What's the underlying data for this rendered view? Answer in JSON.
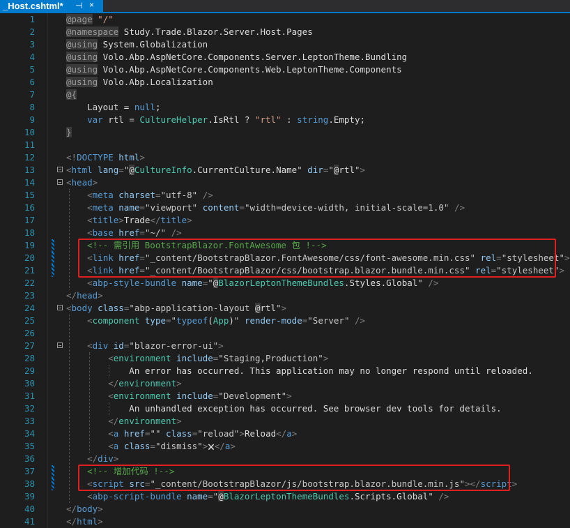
{
  "tab": {
    "title": "_Host.cshtml*",
    "pin_glyph": "⊣",
    "close_glyph": "×"
  },
  "lines": [
    {
      "n": "1",
      "tokens": [
        [
          "dir",
          "@page"
        ],
        [
          "txt",
          " "
        ],
        [
          "str",
          "\"/\""
        ]
      ]
    },
    {
      "n": "2",
      "tokens": [
        [
          "dir",
          "@namespace"
        ],
        [
          "txt",
          " Study.Trade.Blazor.Server.Host.Pages"
        ]
      ]
    },
    {
      "n": "3",
      "tokens": [
        [
          "dir",
          "@using"
        ],
        [
          "txt",
          " System.Globalization"
        ]
      ]
    },
    {
      "n": "4",
      "tokens": [
        [
          "dir",
          "@using"
        ],
        [
          "txt",
          " Volo.Abp.AspNetCore.Components.Server.LeptonTheme.Bundling"
        ]
      ]
    },
    {
      "n": "5",
      "tokens": [
        [
          "dir",
          "@using"
        ],
        [
          "txt",
          " Volo.Abp.AspNetCore.Components.Web.LeptonTheme.Components"
        ]
      ]
    },
    {
      "n": "6",
      "tokens": [
        [
          "dir",
          "@using"
        ],
        [
          "txt",
          " Volo.Abp.Localization"
        ]
      ]
    },
    {
      "n": "7",
      "tokens": [
        [
          "dir",
          "@{"
        ]
      ]
    },
    {
      "n": "8",
      "tokens": [
        [
          "txt",
          "    Layout = "
        ],
        [
          "kw",
          "null"
        ],
        [
          "txt",
          ";"
        ]
      ]
    },
    {
      "n": "9",
      "tokens": [
        [
          "txt",
          "    "
        ],
        [
          "kw",
          "var"
        ],
        [
          "txt",
          " rtl = "
        ],
        [
          "type",
          "CultureHelper"
        ],
        [
          "txt",
          ".IsRtl ? "
        ],
        [
          "str",
          "\"rtl\""
        ],
        [
          "txt",
          " : "
        ],
        [
          "kw",
          "string"
        ],
        [
          "txt",
          ".Empty;"
        ]
      ]
    },
    {
      "n": "10",
      "tokens": [
        [
          "dir",
          "}"
        ]
      ]
    },
    {
      "n": "11",
      "tokens": []
    },
    {
      "n": "12",
      "tokens": [
        [
          "br",
          "<!"
        ],
        [
          "tag",
          "DOCTYPE"
        ],
        [
          "txt",
          " "
        ],
        [
          "attr",
          "html"
        ],
        [
          "br",
          ">"
        ]
      ]
    },
    {
      "n": "13",
      "tokens": [
        [
          "br",
          "<"
        ],
        [
          "tag",
          "html"
        ],
        [
          "txt",
          " "
        ],
        [
          "attr",
          "lang"
        ],
        [
          "br",
          "="
        ],
        [
          "val",
          "\""
        ],
        [
          "razor",
          "@"
        ],
        [
          "type",
          "CultureInfo"
        ],
        [
          "txt",
          ".CurrentCulture.Name"
        ],
        [
          "val",
          "\""
        ],
        [
          "txt",
          " "
        ],
        [
          "attr",
          "dir"
        ],
        [
          "br",
          "="
        ],
        [
          "val",
          "\""
        ],
        [
          "razor",
          "@"
        ],
        [
          "txt",
          "rtl"
        ],
        [
          "val",
          "\""
        ],
        [
          "br",
          ">"
        ]
      ]
    },
    {
      "n": "14",
      "tokens": [
        [
          "br",
          "<"
        ],
        [
          "tag",
          "head"
        ],
        [
          "br",
          ">"
        ]
      ]
    },
    {
      "n": "15",
      "tokens": [
        [
          "txt",
          "    "
        ],
        [
          "br",
          "<"
        ],
        [
          "tag",
          "meta"
        ],
        [
          "txt",
          " "
        ],
        [
          "attr",
          "charset"
        ],
        [
          "br",
          "="
        ],
        [
          "val",
          "\"utf-8\""
        ],
        [
          "txt",
          " "
        ],
        [
          "br",
          "/>"
        ]
      ]
    },
    {
      "n": "16",
      "tokens": [
        [
          "txt",
          "    "
        ],
        [
          "br",
          "<"
        ],
        [
          "tag",
          "meta"
        ],
        [
          "txt",
          " "
        ],
        [
          "attr",
          "name"
        ],
        [
          "br",
          "="
        ],
        [
          "val",
          "\"viewport\""
        ],
        [
          "txt",
          " "
        ],
        [
          "attr",
          "content"
        ],
        [
          "br",
          "="
        ],
        [
          "val",
          "\"width=device-width, initial-scale=1.0\""
        ],
        [
          "txt",
          " "
        ],
        [
          "br",
          "/>"
        ]
      ]
    },
    {
      "n": "17",
      "tokens": [
        [
          "txt",
          "    "
        ],
        [
          "br",
          "<"
        ],
        [
          "tag",
          "title"
        ],
        [
          "br",
          ">"
        ],
        [
          "txt",
          "Trade"
        ],
        [
          "br",
          "</"
        ],
        [
          "tag",
          "title"
        ],
        [
          "br",
          ">"
        ]
      ]
    },
    {
      "n": "18",
      "tokens": [
        [
          "txt",
          "    "
        ],
        [
          "br",
          "<"
        ],
        [
          "tag",
          "base"
        ],
        [
          "txt",
          " "
        ],
        [
          "attr",
          "href"
        ],
        [
          "br",
          "="
        ],
        [
          "val",
          "\"~/\""
        ],
        [
          "txt",
          " "
        ],
        [
          "br",
          "/>"
        ]
      ]
    },
    {
      "n": "19",
      "tokens": [
        [
          "txt",
          "    "
        ],
        [
          "cmt",
          "<!-- 需引用 BootstrapBlazor.FontAwesome 包 !-->"
        ]
      ]
    },
    {
      "n": "20",
      "tokens": [
        [
          "txt",
          "    "
        ],
        [
          "br",
          "<"
        ],
        [
          "tag",
          "link"
        ],
        [
          "txt",
          " "
        ],
        [
          "attr",
          "href"
        ],
        [
          "br",
          "="
        ],
        [
          "val",
          "\"_content/BootstrapBlazor.FontAwesome/css/font-awesome.min.css\""
        ],
        [
          "txt",
          " "
        ],
        [
          "attr",
          "rel"
        ],
        [
          "br",
          "="
        ],
        [
          "val",
          "\"stylesheet\""
        ],
        [
          "br",
          ">"
        ]
      ]
    },
    {
      "n": "21",
      "tokens": [
        [
          "txt",
          "    "
        ],
        [
          "br",
          "<"
        ],
        [
          "tag",
          "link"
        ],
        [
          "txt",
          " "
        ],
        [
          "attr",
          "href"
        ],
        [
          "br",
          "="
        ],
        [
          "val",
          "\"_content/BootstrapBlazor/css/bootstrap.blazor.bundle.min.css\""
        ],
        [
          "txt",
          " "
        ],
        [
          "attr",
          "rel"
        ],
        [
          "br",
          "="
        ],
        [
          "val",
          "\"stylesheet\""
        ],
        [
          "br",
          ">"
        ]
      ]
    },
    {
      "n": "22",
      "tokens": [
        [
          "txt",
          "    "
        ],
        [
          "br",
          "<"
        ],
        [
          "tag",
          "abp-style-bundle"
        ],
        [
          "txt",
          " "
        ],
        [
          "attr",
          "name"
        ],
        [
          "br",
          "="
        ],
        [
          "val",
          "\""
        ],
        [
          "razor",
          "@"
        ],
        [
          "type",
          "BlazorLeptonThemeBundles"
        ],
        [
          "txt",
          ".Styles.Global"
        ],
        [
          "val",
          "\""
        ],
        [
          "txt",
          " "
        ],
        [
          "br",
          "/>"
        ]
      ]
    },
    {
      "n": "23",
      "tokens": [
        [
          "br",
          "</"
        ],
        [
          "tag",
          "head"
        ],
        [
          "br",
          ">"
        ]
      ]
    },
    {
      "n": "24",
      "tokens": [
        [
          "br",
          "<"
        ],
        [
          "tag",
          "body"
        ],
        [
          "txt",
          " "
        ],
        [
          "attr",
          "class"
        ],
        [
          "br",
          "="
        ],
        [
          "val",
          "\"abp-application-layout "
        ],
        [
          "razor",
          "@"
        ],
        [
          "txt",
          "rtl"
        ],
        [
          "val",
          "\""
        ],
        [
          "br",
          ">"
        ]
      ]
    },
    {
      "n": "25",
      "tokens": [
        [
          "txt",
          "    "
        ],
        [
          "br",
          "<"
        ],
        [
          "type",
          "component"
        ],
        [
          "txt",
          " "
        ],
        [
          "attr",
          "type"
        ],
        [
          "br",
          "="
        ],
        [
          "val",
          "\""
        ],
        [
          "kw",
          "typeof"
        ],
        [
          "txt",
          "("
        ],
        [
          "type",
          "App"
        ],
        [
          "txt",
          ")"
        ],
        [
          "val",
          "\""
        ],
        [
          "txt",
          " "
        ],
        [
          "attr",
          "render-mode"
        ],
        [
          "br",
          "="
        ],
        [
          "val",
          "\"Server\""
        ],
        [
          "txt",
          " "
        ],
        [
          "br",
          "/>"
        ]
      ]
    },
    {
      "n": "26",
      "tokens": []
    },
    {
      "n": "27",
      "tokens": [
        [
          "txt",
          "    "
        ],
        [
          "br",
          "<"
        ],
        [
          "tag",
          "div"
        ],
        [
          "txt",
          " "
        ],
        [
          "attr",
          "id"
        ],
        [
          "br",
          "="
        ],
        [
          "val",
          "\"blazor-error-ui\""
        ],
        [
          "br",
          ">"
        ]
      ]
    },
    {
      "n": "28",
      "tokens": [
        [
          "txt",
          "        "
        ],
        [
          "br",
          "<"
        ],
        [
          "type",
          "environment"
        ],
        [
          "txt",
          " "
        ],
        [
          "attr",
          "include"
        ],
        [
          "br",
          "="
        ],
        [
          "val",
          "\"Staging,Production\""
        ],
        [
          "br",
          ">"
        ]
      ]
    },
    {
      "n": "29",
      "tokens": [
        [
          "txt",
          "            An error has occurred. This application may no longer respond until reloaded."
        ]
      ]
    },
    {
      "n": "30",
      "tokens": [
        [
          "txt",
          "        "
        ],
        [
          "br",
          "</"
        ],
        [
          "type",
          "environment"
        ],
        [
          "br",
          ">"
        ]
      ]
    },
    {
      "n": "31",
      "tokens": [
        [
          "txt",
          "        "
        ],
        [
          "br",
          "<"
        ],
        [
          "type",
          "environment"
        ],
        [
          "txt",
          " "
        ],
        [
          "attr",
          "include"
        ],
        [
          "br",
          "="
        ],
        [
          "val",
          "\"Development\""
        ],
        [
          "br",
          ">"
        ]
      ]
    },
    {
      "n": "32",
      "tokens": [
        [
          "txt",
          "            An unhandled exception has occurred. See browser dev tools for details."
        ]
      ]
    },
    {
      "n": "33",
      "tokens": [
        [
          "txt",
          "        "
        ],
        [
          "br",
          "</"
        ],
        [
          "type",
          "environment"
        ],
        [
          "br",
          ">"
        ]
      ]
    },
    {
      "n": "34",
      "tokens": [
        [
          "txt",
          "        "
        ],
        [
          "br",
          "<"
        ],
        [
          "tag",
          "a"
        ],
        [
          "txt",
          " "
        ],
        [
          "attr",
          "href"
        ],
        [
          "br",
          "="
        ],
        [
          "val",
          "\"\""
        ],
        [
          "txt",
          " "
        ],
        [
          "attr",
          "class"
        ],
        [
          "br",
          "="
        ],
        [
          "val",
          "\"reload\""
        ],
        [
          "br",
          ">"
        ],
        [
          "txt",
          "Reload"
        ],
        [
          "br",
          "</"
        ],
        [
          "tag",
          "a"
        ],
        [
          "br",
          ">"
        ]
      ]
    },
    {
      "n": "35",
      "tokens": [
        [
          "txt",
          "        "
        ],
        [
          "br",
          "<"
        ],
        [
          "tag",
          "a"
        ],
        [
          "txt",
          " "
        ],
        [
          "attr",
          "class"
        ],
        [
          "br",
          "="
        ],
        [
          "val",
          "\"dismiss\""
        ],
        [
          "br",
          ">"
        ],
        [
          "txt",
          "🗙"
        ],
        [
          "br",
          "</"
        ],
        [
          "tag",
          "a"
        ],
        [
          "br",
          ">"
        ]
      ]
    },
    {
      "n": "36",
      "tokens": [
        [
          "txt",
          "    "
        ],
        [
          "br",
          "</"
        ],
        [
          "tag",
          "div"
        ],
        [
          "br",
          ">"
        ]
      ]
    },
    {
      "n": "37",
      "tokens": [
        [
          "txt",
          "    "
        ],
        [
          "cmt",
          "<!-- 增加代码 !-->"
        ]
      ]
    },
    {
      "n": "38",
      "tokens": [
        [
          "txt",
          "    "
        ],
        [
          "br",
          "<"
        ],
        [
          "tag",
          "script"
        ],
        [
          "txt",
          " "
        ],
        [
          "attr",
          "src"
        ],
        [
          "br",
          "="
        ],
        [
          "val",
          "\"_content/BootstrapBlazor/js/bootstrap.blazor.bundle.min.js\""
        ],
        [
          "br",
          "></"
        ],
        [
          "tag",
          "script"
        ],
        [
          "br",
          ">"
        ]
      ]
    },
    {
      "n": "39",
      "tokens": [
        [
          "txt",
          "    "
        ],
        [
          "br",
          "<"
        ],
        [
          "tag",
          "abp-script-bundle"
        ],
        [
          "txt",
          " "
        ],
        [
          "attr",
          "name"
        ],
        [
          "br",
          "="
        ],
        [
          "val",
          "\""
        ],
        [
          "razor",
          "@"
        ],
        [
          "type",
          "BlazorLeptonThemeBundles"
        ],
        [
          "txt",
          ".Scripts.Global"
        ],
        [
          "val",
          "\""
        ],
        [
          "txt",
          " "
        ],
        [
          "br",
          "/>"
        ]
      ]
    },
    {
      "n": "40",
      "tokens": [
        [
          "br",
          "</"
        ],
        [
          "tag",
          "body"
        ],
        [
          "br",
          ">"
        ]
      ]
    },
    {
      "n": "41",
      "tokens": [
        [
          "br",
          "</"
        ],
        [
          "tag",
          "html"
        ],
        [
          "br",
          ">"
        ]
      ]
    }
  ]
}
